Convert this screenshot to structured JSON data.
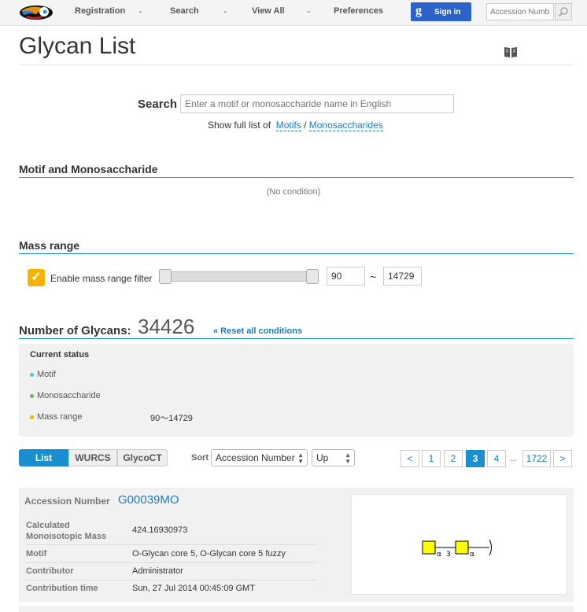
{
  "nav": {
    "items": [
      "Registration",
      "Search",
      "View All",
      "Preferences"
    ],
    "signin_label": "Sign in",
    "signin_icon": "g",
    "accession_placeholder": "Accession Numb"
  },
  "page": {
    "title": "Glycan List"
  },
  "search": {
    "label": "Search",
    "placeholder": "Enter a motif or monosaccharide name in English",
    "full_list_prefix": "Show full list of",
    "motifs_link": "Motifs",
    "separator": "/",
    "monos_link": "Monosaccharides"
  },
  "motif_section": {
    "heading": "Motif and Monosaccharide",
    "empty_text": "(No condition)"
  },
  "mass_section": {
    "heading": "Mass range",
    "checkbox_mark": "✓",
    "enable_label": "Enable mass range filter",
    "min": "90",
    "max": "14729",
    "tilde": "~"
  },
  "count": {
    "label": "Number of Glycans:",
    "value": "34426",
    "reset_label": "« Reset all conditions"
  },
  "status": {
    "title": "Current status",
    "rows": [
      "Motif",
      "Monosaccharide",
      "Mass range"
    ],
    "mass_value": "90〜14729",
    "colors": {
      "motif": "#5bc0de",
      "monosaccharide": "#5cb85c",
      "mass": "#f5b300"
    }
  },
  "view_tabs": [
    "List",
    "WURCS",
    "GlycoCT"
  ],
  "sort": {
    "label": "Sort",
    "field": "Accession Number",
    "direction": "Up"
  },
  "pagination": {
    "prev": "<",
    "pages": [
      "1",
      "2",
      "3",
      "4"
    ],
    "ellipsis": "...",
    "last": "1722",
    "next": ">",
    "current": "3"
  },
  "result": {
    "accession_label": "Accession Number",
    "accession": "G00039MO",
    "mass_label": "Calculated Monoisotopic Mass",
    "mass": "424.16930973",
    "motif_label": "Motif",
    "motif": "O-Glycan core 5, O-Glycan core 5 fuzzy",
    "contributor_label": "Contributor",
    "contributor": "Administrator",
    "time_label": "Contribution time",
    "time": "Sun, 27 Jul 2014 00:45:09 GMT",
    "glycan_labels": {
      "a1": "α",
      "pos": "3",
      "a2": "α"
    }
  },
  "colors": {
    "accent": "#1a8fd0",
    "link": "#1a7bbf",
    "signin": "#2b63c9",
    "checkbox": "#f5b300",
    "galnac": "#ffff00"
  }
}
